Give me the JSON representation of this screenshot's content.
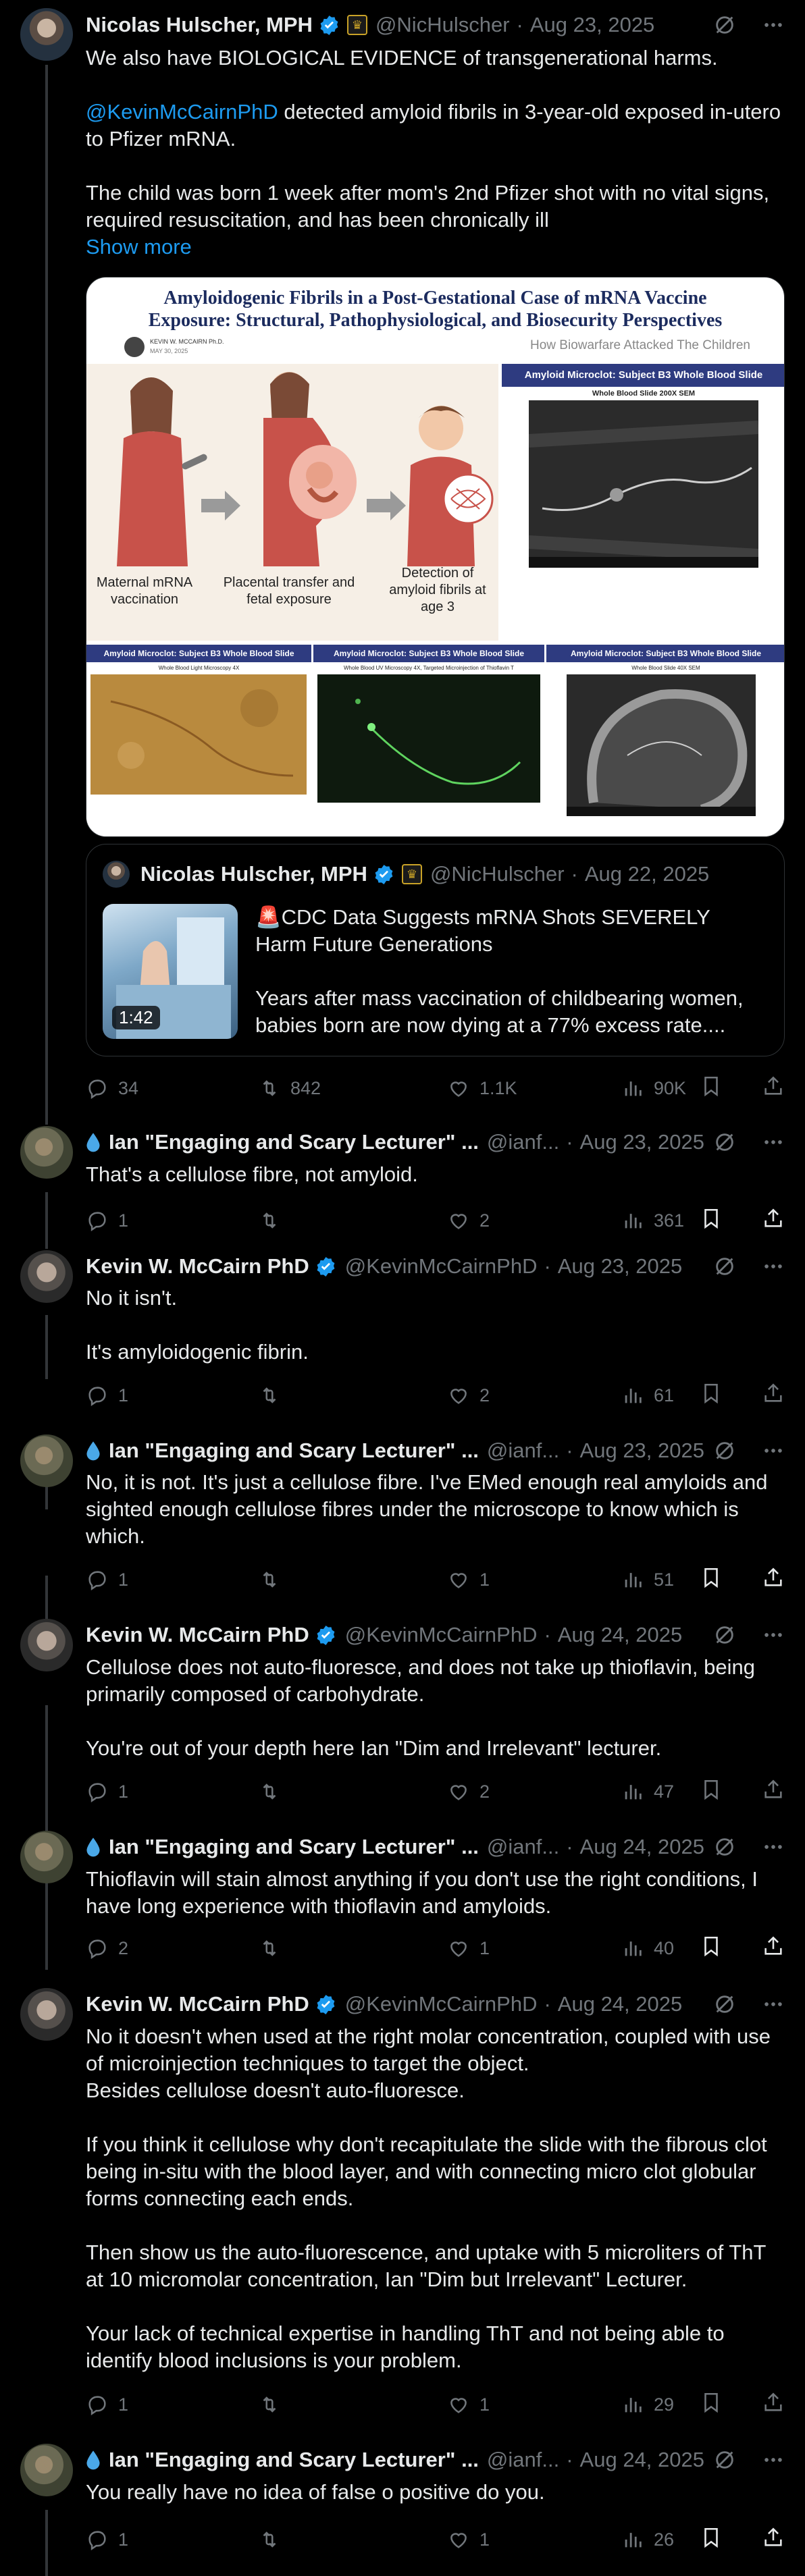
{
  "tweets": [
    {
      "author": "Nicolas Hulscher, MPH",
      "handle": "@NicHulscher",
      "date": "Aug 23, 2025",
      "text": {
        "p1": "We also have BIOLOGICAL EVIDENCE of transgenerational harms.",
        "p2_mention": "@KevinMcCairnPhD",
        "p2_rest": " detected amyloid fibrils in 3-year-old exposed in-utero to Pfizer mRNA.",
        "p3": "The child was born 1 week after mom's 2nd Pfizer shot with no vital signs, required resuscitation, and has been chronically ill",
        "show_more": "Show more"
      },
      "image": {
        "title": "Amyloidogenic Fibrils in a Post-Gestational Case of mRNA Vaccine Exposure: Structural, Pathophysiological, and Biosecurity Perspectives",
        "author": "KEVIN W. MCCAIRN Ph.D.",
        "date": "MAY 30, 2025",
        "subtitle": "How Biowarfare Attacked The Children",
        "step1": "Maternal mRNA vaccination",
        "step2": "Placental transfer and fetal exposure",
        "step3": "Detection of amyloid fibrils at age 3",
        "panel_top_title": "Amyloid Microclot: Subject B3 Whole Blood Slide",
        "panel_top_sub": "Whole Blood Slide 200X SEM",
        "panel1_title": "Amyloid Microclot: Subject B3 Whole Blood Slide",
        "panel1_sub": "Whole Blood Light Microscopy 4X",
        "panel2_title": "Amyloid Microclot: Subject B3 Whole Blood Slide",
        "panel2_sub": "Whole Blood UV Microscopy 4X, Targeted Microinjection of Thioflavin T",
        "panel3_title": "Amyloid Microclot: Subject B3 Whole Blood Slide",
        "panel3_sub": "Whole Blood Slide 40X SEM"
      },
      "quote": {
        "author": "Nicolas Hulscher, MPH",
        "handle": "@NicHulscher",
        "date": "Aug 22, 2025",
        "video_duration": "1:42",
        "headline": "🚨CDC Data Suggests mRNA Shots SEVERELY Harm Future Generations",
        "text": "Years after mass vaccination of childbearing women, babies born are now dying at a 77% excess rate...."
      },
      "stats": {
        "replies": "34",
        "reposts": "842",
        "likes": "1.1K",
        "views": "90K"
      }
    },
    {
      "author": "Ian \"Engaging and Scary Lecturer\" ...",
      "handle": "@ianf...",
      "date": "Aug 23, 2025",
      "lines": [
        "That's a cellulose fibre, not amyloid."
      ],
      "stats": {
        "replies": "1",
        "reposts": "",
        "likes": "2",
        "views": "361"
      }
    },
    {
      "author": "Kevin W. McCairn PhD",
      "handle": "@KevinMcCairnPhD",
      "date": "Aug 23, 2025",
      "lines": [
        "No it isn't.",
        "",
        "It's amyloidogenic fibrin."
      ],
      "stats": {
        "replies": "1",
        "reposts": "",
        "likes": "2",
        "views": "61"
      }
    },
    {
      "author": "Ian \"Engaging and Scary Lecturer\" ...",
      "handle": "@ianf...",
      "date": "Aug 23, 2025",
      "lines": [
        "No, it is not. It's just a cellulose fibre. I've EMed enough real amyloids and sighted enough cellulose fibres under the microscope to know which is which."
      ],
      "stats": {
        "replies": "1",
        "reposts": "",
        "likes": "1",
        "views": "51"
      }
    },
    {
      "author": "Kevin W. McCairn PhD",
      "handle": "@KevinMcCairnPhD",
      "date": "Aug 24, 2025",
      "lines": [
        "Cellulose does not auto-fluoresce, and does not take up thioflavin, being primarily composed of carbohydrate.",
        "",
        "You're out of your depth here Ian \"Dim and Irrelevant\" lecturer."
      ],
      "stats": {
        "replies": "1",
        "reposts": "",
        "likes": "2",
        "views": "47"
      }
    },
    {
      "author": "Ian \"Engaging and Scary Lecturer\" ...",
      "handle": "@ianf...",
      "date": "Aug 24, 2025",
      "lines": [
        "Thioflavin will stain almost anything if you don't use the right conditions, I have long experience with thioflavin and amyloids."
      ],
      "stats": {
        "replies": "2",
        "reposts": "",
        "likes": "1",
        "views": "40"
      }
    },
    {
      "author": "Kevin W. McCairn PhD",
      "handle": "@KevinMcCairnPhD",
      "date": "Aug 24, 2025",
      "lines": [
        "No it doesn't when used at the right molar concentration, coupled with use of microinjection techniques to target the object.",
        "Besides cellulose doesn't auto-fluoresce.",
        "",
        "If you think it cellulose why don't recapitulate the slide with the fibrous clot being in-situ with the blood layer, and with connecting micro clot globular forms connecting each ends.",
        "",
        "Then show us the auto-fluorescence, and uptake with 5 microliters of ThT at 10 micromolar concentration, Ian \"Dim but Irrelevant\" Lecturer.",
        "",
        "Your lack of technical expertise in handling ThT and not  being able to identify blood inclusions is your problem."
      ],
      "stats": {
        "replies": "1",
        "reposts": "",
        "likes": "1",
        "views": "29"
      }
    },
    {
      "author": "Ian \"Engaging and Scary Lecturer\" ...",
      "handle": "@ianf...",
      "date": "Aug 24, 2025",
      "lines": [
        "You really have no idea of false o positive do you."
      ],
      "stats": {
        "replies": "1",
        "reposts": "",
        "likes": "1",
        "views": "26"
      }
    }
  ],
  "colors": {
    "accent": "#1d9bf0",
    "muted": "#71767b",
    "text": "#e7e9ea",
    "verified": "#1d9bf0",
    "image_header": "#2e3b80"
  }
}
